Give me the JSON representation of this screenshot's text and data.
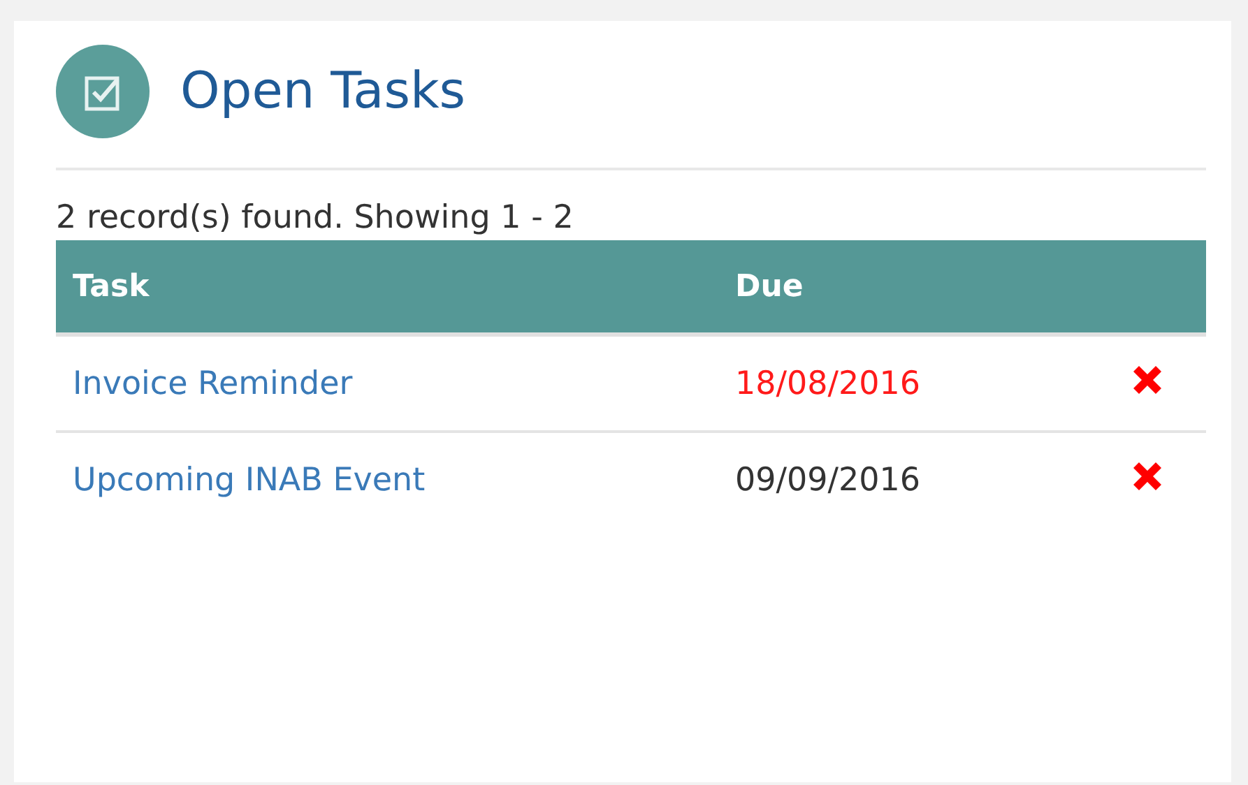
{
  "panel": {
    "title": "Open Tasks"
  },
  "summary": "2 record(s) found. Showing 1 - 2",
  "table": {
    "columns": [
      "Task",
      "Due"
    ],
    "rows": [
      {
        "task": "Invoice Reminder",
        "due": "18/08/2016",
        "overdue": true
      },
      {
        "task": "Upcoming INAB Event",
        "due": "09/09/2016",
        "overdue": false
      }
    ]
  }
}
